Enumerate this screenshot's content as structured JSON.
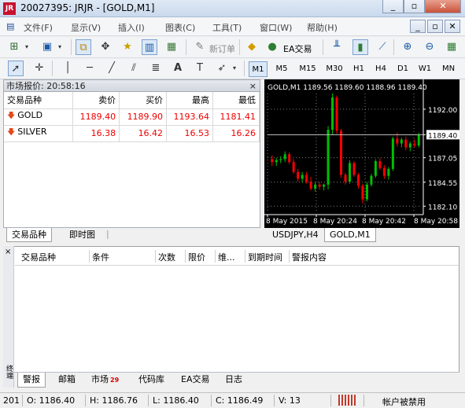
{
  "window": {
    "title": "20027395: JRJR - [GOLD,M1]",
    "controls": [
      "_",
      "▫",
      "✕"
    ],
    "inner_controls": [
      "_",
      "▫",
      "✕"
    ]
  },
  "menu": [
    "文件(F)",
    "显示(V)",
    "插入(I)",
    "图表(C)",
    "工具(T)",
    "窗口(W)",
    "帮助(H)"
  ],
  "toolbar": {
    "new_order": "新订单",
    "ea_trading": "EA交易"
  },
  "timeframes": [
    "M1",
    "M5",
    "M15",
    "M30",
    "H1",
    "H4",
    "D1",
    "W1",
    "MN"
  ],
  "timeframe_selected": "M1",
  "market_watch": {
    "title": "市场报价: 20:58:16",
    "columns": [
      "交易品种",
      "卖价",
      "买价",
      "最高",
      "最低"
    ],
    "rows": [
      {
        "symbol": "GOLD",
        "bid": "1189.40",
        "ask": "1189.90",
        "high": "1193.64",
        "low": "1181.41",
        "direction": "down"
      },
      {
        "symbol": "SILVER",
        "bid": "16.38",
        "ask": "16.42",
        "high": "16.53",
        "low": "16.26",
        "direction": "down"
      }
    ],
    "tabs": [
      "交易品种",
      "即时图"
    ],
    "active_tab": "交易品种"
  },
  "chart": {
    "header": "GOLD,M1  1189.56 1189.60 1188.96 1189.40",
    "current_price": "1189.40",
    "price_ticks": [
      "1192.00",
      "1189.40",
      "1187.05",
      "1184.55",
      "1182.10"
    ],
    "time_ticks": [
      "8 May 2015",
      "8 May 20:24",
      "8 May 20:42",
      "8 May 20:58"
    ],
    "tabs": [
      "USDJPY,H4",
      "GOLD,M1"
    ],
    "active_tab": "GOLD,M1",
    "colors": {
      "background": "#000000",
      "bull": "#00c000",
      "bear": "#ff0000",
      "grid": "#808080",
      "text": "#ffffff"
    }
  },
  "chart_data": {
    "type": "candlestick",
    "title": "GOLD,M1",
    "ylim": [
      1181.4,
      1193.6
    ],
    "x_labels": [
      "8 May 2015",
      "8 May 20:24",
      "8 May 20:42",
      "8 May 20:58"
    ],
    "ohlc": [
      [
        1186.9,
        1187.3,
        1186.2,
        1186.6
      ],
      [
        1186.6,
        1187.0,
        1186.2,
        1186.8
      ],
      [
        1186.8,
        1187.2,
        1186.5,
        1186.9
      ],
      [
        1186.9,
        1187.7,
        1186.6,
        1187.4
      ],
      [
        1187.4,
        1187.6,
        1186.4,
        1186.6
      ],
      [
        1186.6,
        1186.9,
        1185.4,
        1185.6
      ],
      [
        1185.6,
        1185.9,
        1184.6,
        1184.9
      ],
      [
        1184.9,
        1185.6,
        1184.5,
        1185.3
      ],
      [
        1185.3,
        1185.6,
        1184.4,
        1184.6
      ],
      [
        1184.6,
        1185.1,
        1183.7,
        1183.9
      ],
      [
        1183.9,
        1184.5,
        1183.6,
        1184.3
      ],
      [
        1184.3,
        1184.6,
        1183.8,
        1184.1
      ],
      [
        1184.1,
        1184.4,
        1183.7,
        1184.3
      ],
      [
        1184.3,
        1190.3,
        1183.8,
        1189.9
      ],
      [
        1189.9,
        1193.6,
        1189.4,
        1193.2
      ],
      [
        1193.2,
        1193.4,
        1189.5,
        1189.8
      ],
      [
        1189.8,
        1190.0,
        1185.0,
        1185.3
      ],
      [
        1185.3,
        1185.5,
        1184.3,
        1184.6
      ],
      [
        1184.6,
        1186.8,
        1184.4,
        1186.5
      ],
      [
        1186.5,
        1186.7,
        1185.1,
        1185.3
      ],
      [
        1185.3,
        1185.5,
        1183.9,
        1184.2
      ],
      [
        1184.2,
        1184.4,
        1182.4,
        1182.8
      ],
      [
        1182.8,
        1184.6,
        1182.6,
        1184.3
      ],
      [
        1184.3,
        1185.4,
        1184.1,
        1185.2
      ],
      [
        1185.2,
        1186.9,
        1185.0,
        1186.7
      ],
      [
        1186.7,
        1187.0,
        1185.8,
        1186.0
      ],
      [
        1186.0,
        1186.3,
        1184.9,
        1185.2
      ],
      [
        1185.2,
        1186.1,
        1184.8,
        1185.9
      ],
      [
        1185.9,
        1189.2,
        1185.7,
        1189.0
      ],
      [
        1189.0,
        1189.6,
        1188.2,
        1188.5
      ],
      [
        1188.5,
        1189.1,
        1188.1,
        1188.9
      ],
      [
        1188.9,
        1189.2,
        1187.8,
        1188.1
      ],
      [
        1188.1,
        1188.7,
        1187.7,
        1188.5
      ],
      [
        1188.5,
        1188.9,
        1188.1,
        1188.3
      ],
      [
        1188.3,
        1189.6,
        1188.1,
        1189.4
      ]
    ]
  },
  "terminal": {
    "columns": [
      "交易品种",
      "条件",
      "次数",
      "限价",
      "维...",
      "到期时间",
      "警报内容"
    ],
    "tabs": [
      {
        "label": "警报",
        "badge": ""
      },
      {
        "label": "邮箱",
        "badge": ""
      },
      {
        "label": "市场",
        "badge": "29"
      },
      {
        "label": "代码库",
        "badge": ""
      },
      {
        "label": "EA交易",
        "badge": ""
      },
      {
        "label": "日志",
        "badge": ""
      }
    ],
    "active_tab": "警报",
    "side_label": "终端"
  },
  "status": {
    "id": "201",
    "open": "O: 1186.40",
    "high": "H: 1186.76",
    "low": "L: 1186.40",
    "close": "C: 1186.49",
    "volume": "V: 13",
    "account": "帐户被禁用"
  }
}
